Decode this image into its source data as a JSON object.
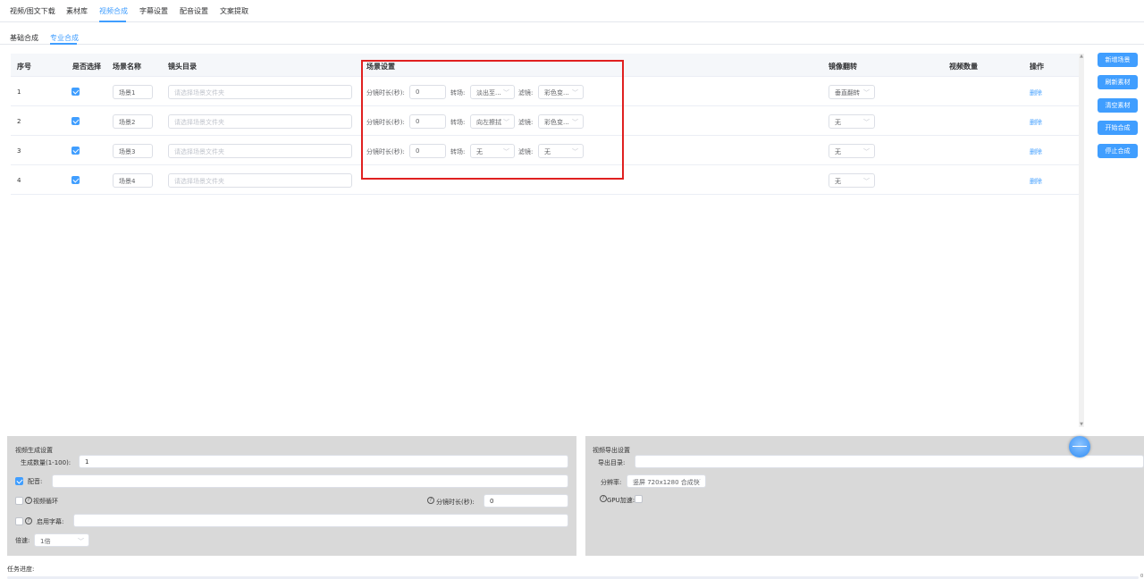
{
  "topnav": {
    "tabs": [
      {
        "label": "视频/图文下载"
      },
      {
        "label": "素材库"
      },
      {
        "label": "视频合成"
      },
      {
        "label": "字幕设置"
      },
      {
        "label": "配音设置"
      },
      {
        "label": "文案提取"
      }
    ],
    "active": "视频合成"
  },
  "subnav": {
    "tabs": [
      {
        "label": "基础合成"
      },
      {
        "label": "专业合成"
      }
    ],
    "active": "专业合成"
  },
  "table": {
    "headers": {
      "index": "序号",
      "select": "是否选择",
      "scene_name": "场景名称",
      "shot_dir": "镜头目录",
      "scene_settings": "场景设置",
      "mirror": "镜像翻转",
      "video_count": "视频数量",
      "actions": "操作"
    },
    "labels": {
      "duration": "分镜时长(秒):",
      "transition": "转场:",
      "filter": "滤镜:",
      "delete": "删除",
      "dir_placeholder": "请选择场景文件夹"
    },
    "rows": [
      {
        "index": "1",
        "checked": true,
        "name": "场景1",
        "duration": "0",
        "transition": "淡出至...",
        "filter": "彩色变...",
        "mirror": "垂直翻转",
        "has_settings": true
      },
      {
        "index": "2",
        "checked": true,
        "name": "场景2",
        "duration": "0",
        "transition": "向左擦拭",
        "filter": "彩色变...",
        "mirror": "无",
        "has_settings": true
      },
      {
        "index": "3",
        "checked": true,
        "name": "场景3",
        "duration": "0",
        "transition": "无",
        "filter": "无",
        "mirror": "无",
        "has_settings": true
      },
      {
        "index": "4",
        "checked": true,
        "name": "场景4",
        "duration": "",
        "transition": "",
        "filter": "",
        "mirror": "无",
        "has_settings": false
      }
    ]
  },
  "side_buttons": {
    "add_scene": "新增场景",
    "refresh": "刷新素材",
    "clear": "清空素材",
    "start": "开始合成",
    "stop": "停止合成"
  },
  "gen_panel": {
    "title": "视频生成设置",
    "count_label": "生成数量(1-100):",
    "count_value": "1",
    "dub_label": "配音:",
    "dub_checked": true,
    "loop_label": "视频循环",
    "loop_checked": false,
    "duration_label": "分镜时长(秒):",
    "duration_value": "0",
    "subtitle_label": "启用字幕:",
    "subtitle_checked": false,
    "speed_label": "倍速:",
    "speed_value": "1倍",
    "help_glyph": "?"
  },
  "export_panel": {
    "title": "视频导出设置",
    "dir_label": "导出目录:",
    "res_label": "分辨率:",
    "res_value": "竖屏 720x1280 合成快",
    "gpu_label": "GPU加速:",
    "gpu_checked": false,
    "help_glyph": "?"
  },
  "progress": {
    "label": "任务进度:",
    "value": 0,
    "value_text": "0"
  },
  "colors": {
    "accent": "#409eff",
    "highlight_box": "#e02020",
    "panel_bg": "#d9d9d9"
  }
}
